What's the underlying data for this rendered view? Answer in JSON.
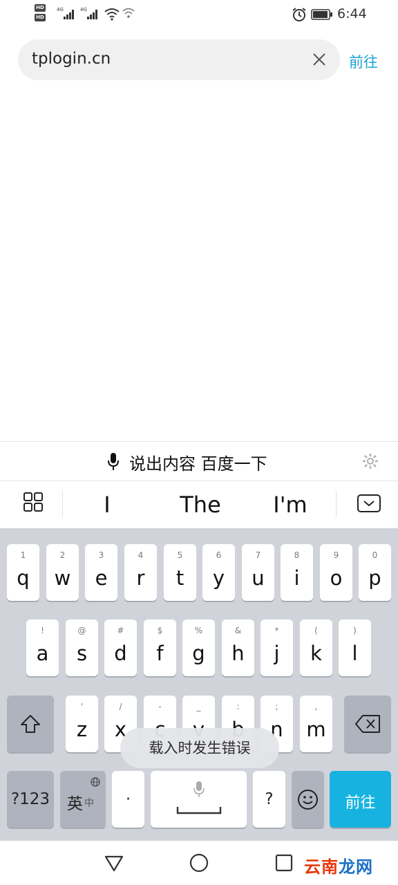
{
  "status_bar": {
    "sim1_badge": "HD",
    "sim2_badge": "HD",
    "network_1": "4G",
    "network_2": "4G",
    "icons": [
      "hd-icon",
      "signal-icon",
      "signal-icon",
      "wifi-icon",
      "hotspot-icon",
      "alarm-icon",
      "battery-icon"
    ],
    "time": "6:44"
  },
  "address_bar": {
    "url": "tplogin.cn",
    "clear_icon": "close-icon",
    "go_label": "前往"
  },
  "voice_strip": {
    "mic_icon": "microphone-icon",
    "prompt": "说出内容 百度一下",
    "settings_icon": "gear-icon"
  },
  "candidates": {
    "grid_icon": "grid-icon",
    "words": [
      "I",
      "The",
      "I'm"
    ],
    "collapse_icon": "keyboard-collapse-icon"
  },
  "keyboard": {
    "row1": [
      {
        "hint": "1",
        "char": "q"
      },
      {
        "hint": "2",
        "char": "w"
      },
      {
        "hint": "3",
        "char": "e"
      },
      {
        "hint": "4",
        "char": "r"
      },
      {
        "hint": "5",
        "char": "t"
      },
      {
        "hint": "6",
        "char": "y"
      },
      {
        "hint": "7",
        "char": "u"
      },
      {
        "hint": "8",
        "char": "i"
      },
      {
        "hint": "9",
        "char": "o"
      },
      {
        "hint": "0",
        "char": "p"
      }
    ],
    "row2": [
      {
        "hint": "!",
        "char": "a"
      },
      {
        "hint": "@",
        "char": "s"
      },
      {
        "hint": "#",
        "char": "d"
      },
      {
        "hint": "$",
        "char": "f"
      },
      {
        "hint": "%",
        "char": "g"
      },
      {
        "hint": "&",
        "char": "h"
      },
      {
        "hint": "*",
        "char": "j"
      },
      {
        "hint": "(",
        "char": "k"
      },
      {
        "hint": ")",
        "char": "l"
      }
    ],
    "row3": [
      {
        "hint": "'",
        "char": "z"
      },
      {
        "hint": "/",
        "char": "x"
      },
      {
        "hint": "-",
        "char": "c"
      },
      {
        "hint": "_",
        "char": "v"
      },
      {
        "hint": ":",
        "char": "b"
      },
      {
        "hint": ";",
        "char": "n"
      },
      {
        "hint": ",",
        "char": "m"
      }
    ],
    "shift_icon": "shift-icon",
    "backspace_icon": "backspace-icon",
    "num_label": "?123",
    "lang_main": "英",
    "lang_sub": "中",
    "lang_icon": "globe-icon",
    "dot_label": "·",
    "space_icon": "microphone-icon",
    "question_label": "?",
    "emoji_icon": "smiley-icon",
    "enter_label": "前往"
  },
  "toast": {
    "message": "载入时发生错误"
  },
  "nav_bar": {
    "back_icon": "back-triangle-icon",
    "home_icon": "home-circle-icon",
    "recents_icon": "recents-square-icon"
  },
  "watermark": {
    "part1": "云南",
    "part2": "龙网"
  },
  "colors": {
    "accent": "#1aa2d3",
    "enter_key": "#17b3e0",
    "keyboard_bg": "#d1d3da",
    "dark_key": "#aeb3bd",
    "watermark_red": "#e8380d",
    "watermark_blue": "#1b6fc6"
  }
}
